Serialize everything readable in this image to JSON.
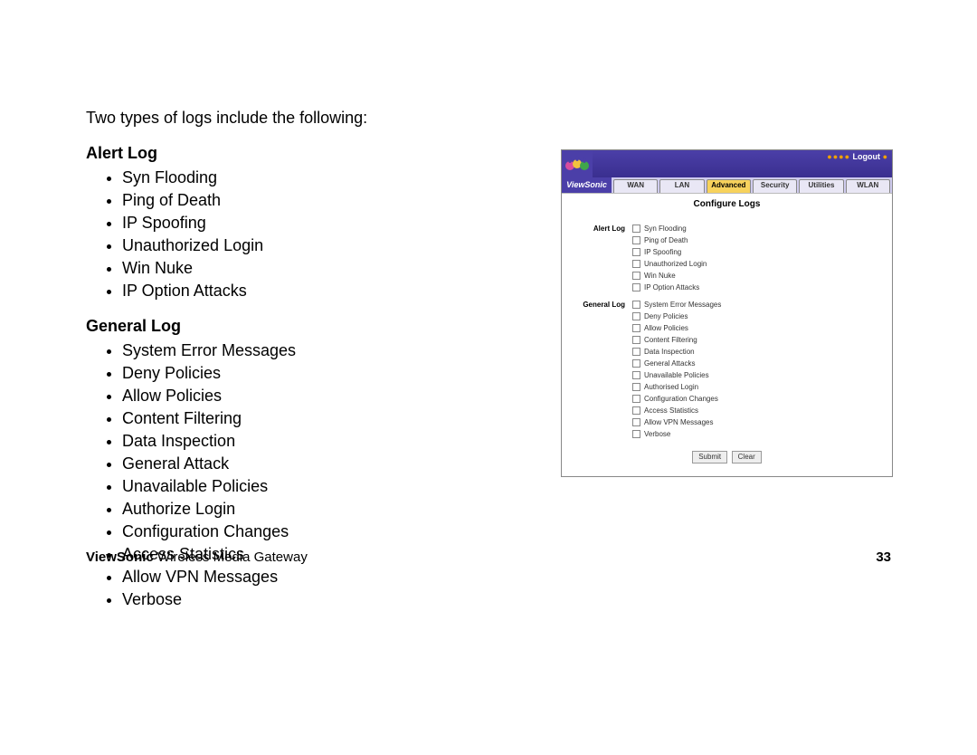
{
  "intro": "Two types of logs include the following:",
  "sections": {
    "alert": {
      "heading": "Alert Log",
      "items": [
        "Syn Flooding",
        "Ping of Death",
        "IP Spoofing",
        "Unauthorized Login",
        "Win Nuke",
        "IP Option Attacks"
      ]
    },
    "general": {
      "heading": "General Log",
      "items": [
        "System Error Messages",
        "Deny Policies",
        "Allow Policies",
        "Content Filtering",
        "Data Inspection",
        "General Attack",
        "Unavailable Policies",
        "Authorize Login",
        "Configuration Changes",
        "Access Statistics",
        "Allow VPN Messages",
        "Verbose"
      ]
    }
  },
  "screenshot": {
    "brand": "ViewSonic",
    "logout": "Logout",
    "tabs": [
      "WAN",
      "LAN",
      "Advanced",
      "Security",
      "Utilities",
      "WLAN"
    ],
    "active_tab_index": 2,
    "panel_title": "Configure Logs",
    "groups": {
      "alert": {
        "label": "Alert Log",
        "items": [
          "Syn Flooding",
          "Ping of Death",
          "IP Spoofing",
          "Unauthorized Login",
          "Win Nuke",
          "IP Option Attacks"
        ]
      },
      "general": {
        "label": "General Log",
        "items": [
          "System Error Messages",
          "Deny Policies",
          "Allow Policies",
          "Content Filtering",
          "Data Inspection",
          "General Attacks",
          "Unavailable Policies",
          "Authorised Login",
          "Configuration Changes",
          "Access Statistics",
          "Allow VPN Messages",
          "Verbose"
        ]
      }
    },
    "buttons": {
      "submit": "Submit",
      "clear": "Clear"
    }
  },
  "footer": {
    "brand": "ViewSonic",
    "product": " Wireless Media Gateway",
    "page": "33"
  }
}
